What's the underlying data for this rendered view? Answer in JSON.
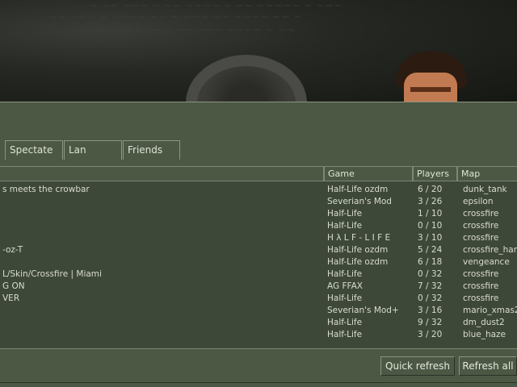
{
  "tabs": [
    {
      "label": "Spectate"
    },
    {
      "label": "Lan"
    },
    {
      "label": "Friends"
    }
  ],
  "columns": {
    "game": "Game",
    "players": "Players",
    "map": "Map"
  },
  "servers": [
    {
      "name": "s meets the crowbar",
      "game": "Half-Life ozdm",
      "players": "6 / 20",
      "map": "dunk_tank"
    },
    {
      "name": "",
      "game": "Severian's Mod",
      "players": "3 / 26",
      "map": "epsilon"
    },
    {
      "name": "",
      "game": "Half-Life",
      "players": "1 / 10",
      "map": "crossfire"
    },
    {
      "name": "",
      "game": "Half-Life",
      "players": "0 / 10",
      "map": "crossfire"
    },
    {
      "name": "",
      "game": "H λ L F - L I F E",
      "players": "3 / 10",
      "map": "crossfire"
    },
    {
      "name": "-oz-T",
      "game": "Half-Life ozdm",
      "players": "5 / 24",
      "map": "crossfire_har"
    },
    {
      "name": "",
      "game": "Half-Life ozdm",
      "players": "6 / 18",
      "map": "vengeance"
    },
    {
      "name": "L/Skin/Crossfire | Miami",
      "game": "Half-Life",
      "players": "0 / 32",
      "map": "crossfire"
    },
    {
      "name": "G ON",
      "game": "AG FFAX",
      "players": "7 / 32",
      "map": "crossfire"
    },
    {
      "name": "VER",
      "game": "Half-Life",
      "players": "0 / 32",
      "map": "crossfire"
    },
    {
      "name": "",
      "game": "Severian's Mod+",
      "players": "3 / 16",
      "map": "mario_xmas2"
    },
    {
      "name": "",
      "game": "Half-Life",
      "players": "9 / 32",
      "map": "dm_dust2"
    },
    {
      "name": "",
      "game": "Half-Life",
      "players": "3 / 20",
      "map": "blue_haze"
    }
  ],
  "buttons": {
    "quick_refresh": "Quick refresh",
    "refresh_all": "Refresh all"
  }
}
